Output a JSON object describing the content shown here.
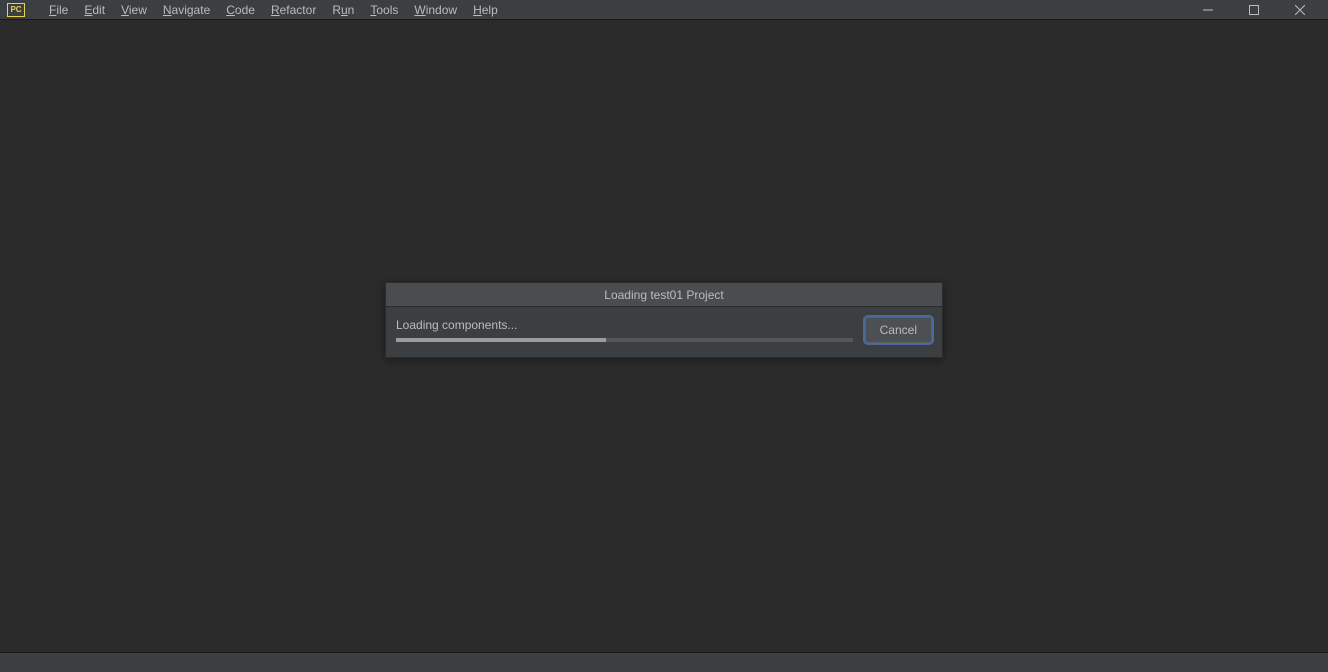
{
  "app_icon": "PC",
  "menu": {
    "items": [
      {
        "label": "File",
        "underline": 0
      },
      {
        "label": "Edit",
        "underline": 0
      },
      {
        "label": "View",
        "underline": 0
      },
      {
        "label": "Navigate",
        "underline": 0
      },
      {
        "label": "Code",
        "underline": 0
      },
      {
        "label": "Refactor",
        "underline": 0
      },
      {
        "label": "Run",
        "underline": 1
      },
      {
        "label": "Tools",
        "underline": 0
      },
      {
        "label": "Window",
        "underline": 0
      },
      {
        "label": "Help",
        "underline": 0
      }
    ]
  },
  "dialog": {
    "title": "Loading test01 Project",
    "status": "Loading components...",
    "progress_percent": 46,
    "cancel_label": "Cancel"
  }
}
